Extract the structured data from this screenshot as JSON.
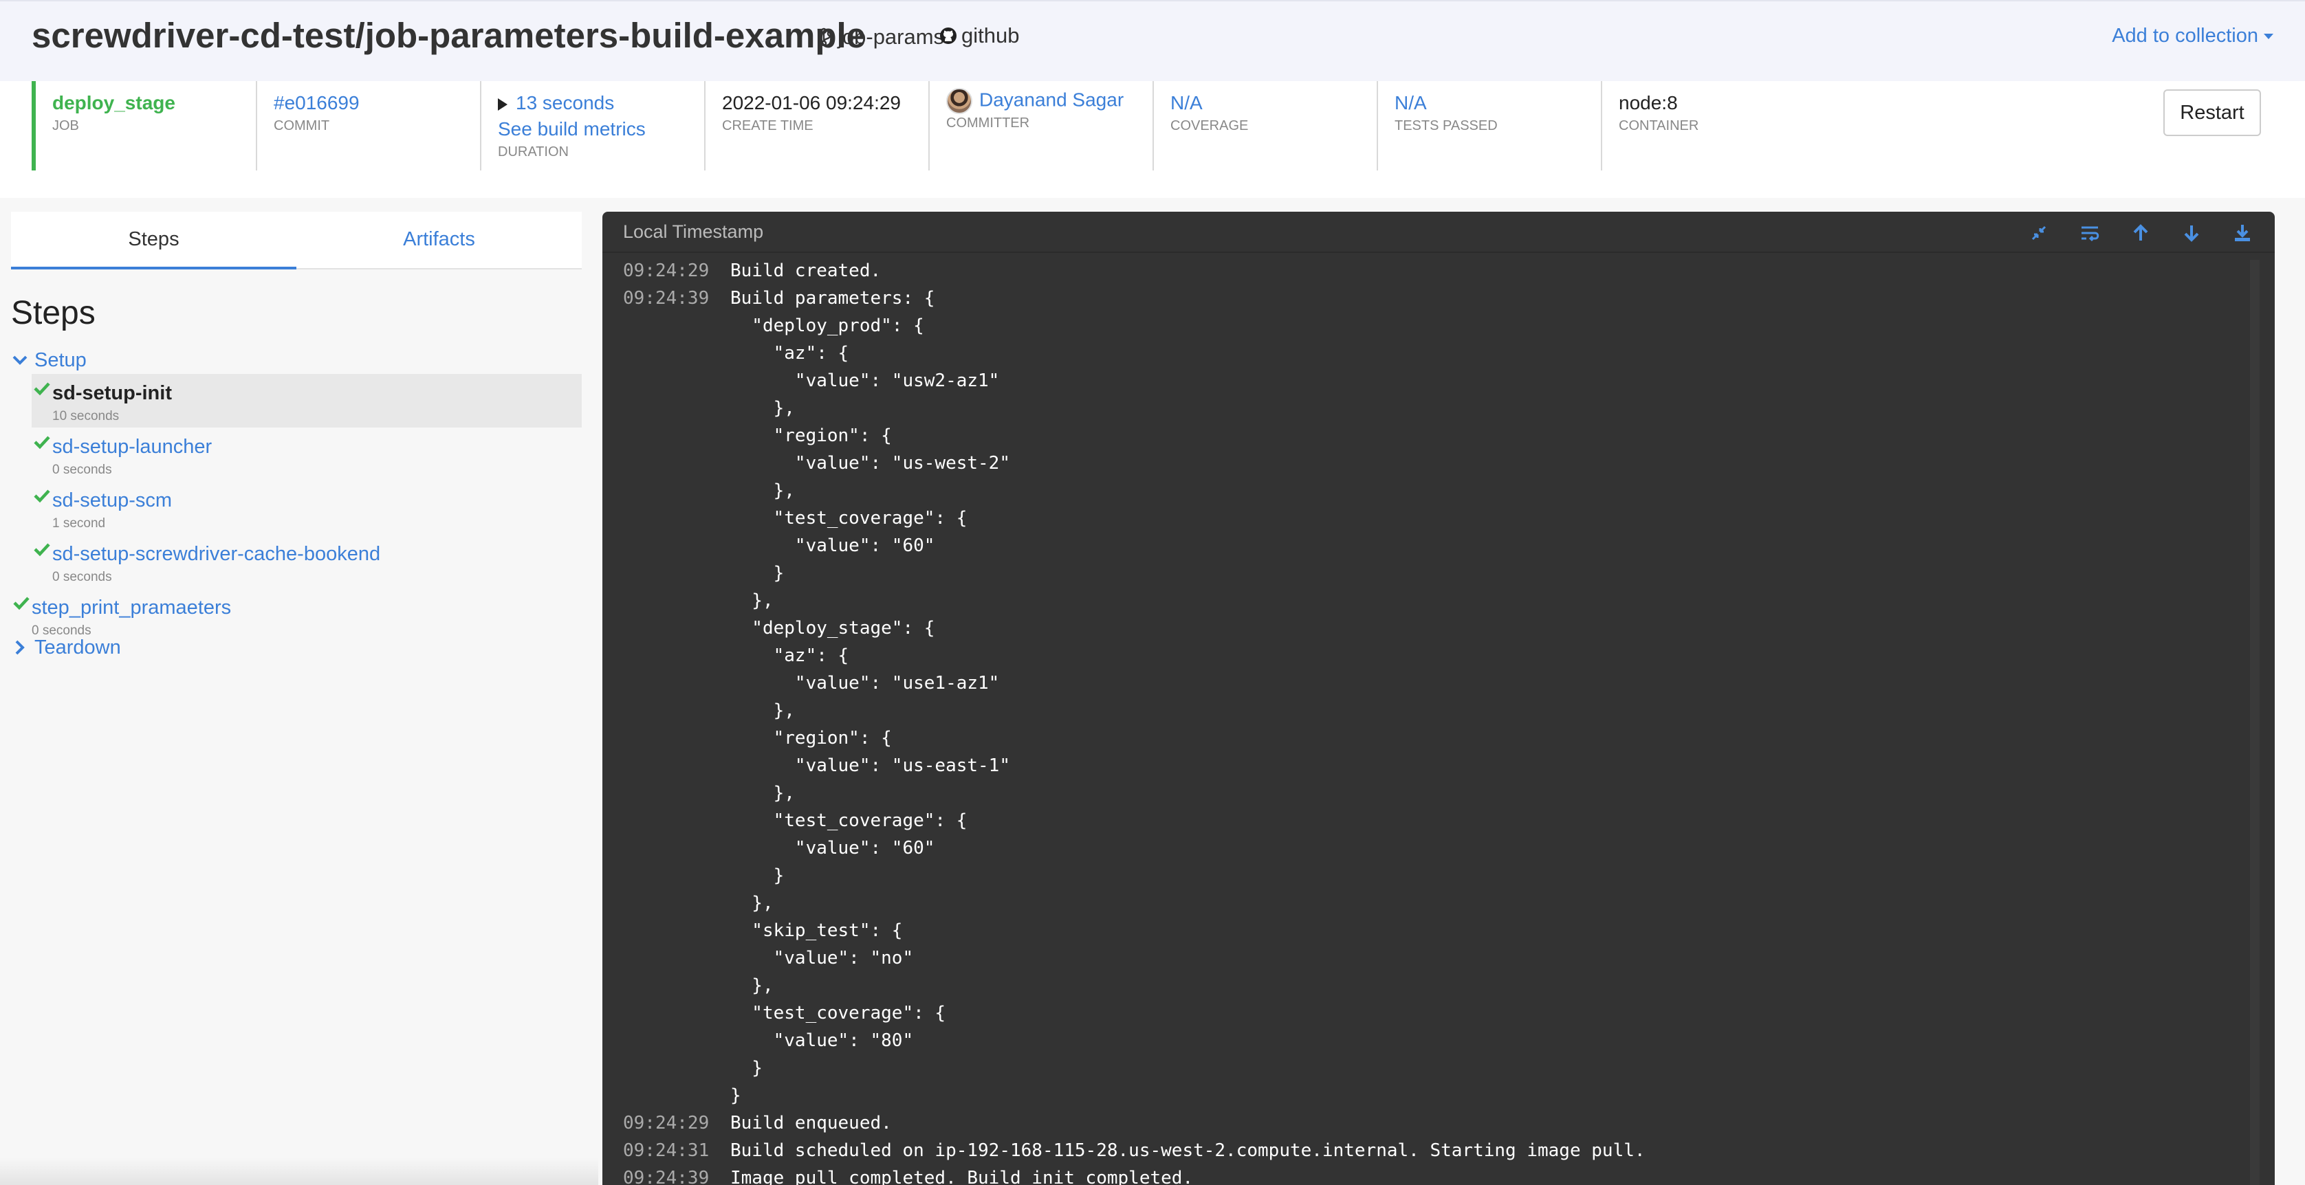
{
  "header": {
    "title": "screwdriver-cd-test/job-parameters-build-example",
    "branch": "job-params",
    "repo_source": "github",
    "add_to_collection": "Add to collection"
  },
  "info": {
    "job": {
      "value": "deploy_stage",
      "label": "JOB"
    },
    "commit": {
      "value": "#e016699",
      "label": "COMMIT"
    },
    "duration": {
      "value": "13 seconds",
      "metrics_link": "See build metrics",
      "label": "DURATION"
    },
    "create_time": {
      "value": "2022-01-06 09:24:29",
      "label": "CREATE TIME"
    },
    "committer": {
      "value": "Dayanand Sagar",
      "label": "COMMITTER"
    },
    "coverage": {
      "value": "N/A",
      "label": "COVERAGE"
    },
    "tests": {
      "value": "N/A",
      "label": "TESTS PASSED"
    },
    "container": {
      "value": "node:8",
      "label": "CONTAINER"
    },
    "restart_label": "Restart"
  },
  "tabs": {
    "steps": "Steps",
    "artifacts": "Artifacts"
  },
  "steps_heading": "Steps",
  "steps": {
    "setup_label": "Setup",
    "setup_steps": [
      {
        "name": "sd-setup-init",
        "duration": "10 seconds"
      },
      {
        "name": "sd-setup-launcher",
        "duration": "0 seconds"
      },
      {
        "name": "sd-setup-scm",
        "duration": "1 second"
      },
      {
        "name": "sd-setup-screwdriver-cache-bookend",
        "duration": "0 seconds"
      }
    ],
    "user_step": {
      "name": "step_print_pramaeters",
      "duration": "0 seconds"
    },
    "teardown_label": "Teardown"
  },
  "log": {
    "title": "Local Timestamp",
    "lines": [
      {
        "ts": "09:24:29",
        "text": "Build created."
      },
      {
        "ts": "09:24:39",
        "text": "Build parameters: {"
      },
      {
        "ts": "",
        "text": "  \"deploy_prod\": {"
      },
      {
        "ts": "",
        "text": "    \"az\": {"
      },
      {
        "ts": "",
        "text": "      \"value\": \"usw2-az1\""
      },
      {
        "ts": "",
        "text": "    },"
      },
      {
        "ts": "",
        "text": "    \"region\": {"
      },
      {
        "ts": "",
        "text": "      \"value\": \"us-west-2\""
      },
      {
        "ts": "",
        "text": "    },"
      },
      {
        "ts": "",
        "text": "    \"test_coverage\": {"
      },
      {
        "ts": "",
        "text": "      \"value\": \"60\""
      },
      {
        "ts": "",
        "text": "    }"
      },
      {
        "ts": "",
        "text": "  },"
      },
      {
        "ts": "",
        "text": "  \"deploy_stage\": {"
      },
      {
        "ts": "",
        "text": "    \"az\": {"
      },
      {
        "ts": "",
        "text": "      \"value\": \"use1-az1\""
      },
      {
        "ts": "",
        "text": "    },"
      },
      {
        "ts": "",
        "text": "    \"region\": {"
      },
      {
        "ts": "",
        "text": "      \"value\": \"us-east-1\""
      },
      {
        "ts": "",
        "text": "    },"
      },
      {
        "ts": "",
        "text": "    \"test_coverage\": {"
      },
      {
        "ts": "",
        "text": "      \"value\": \"60\""
      },
      {
        "ts": "",
        "text": "    }"
      },
      {
        "ts": "",
        "text": "  },"
      },
      {
        "ts": "",
        "text": "  \"skip_test\": {"
      },
      {
        "ts": "",
        "text": "    \"value\": \"no\""
      },
      {
        "ts": "",
        "text": "  },"
      },
      {
        "ts": "",
        "text": "  \"test_coverage\": {"
      },
      {
        "ts": "",
        "text": "    \"value\": \"80\""
      },
      {
        "ts": "",
        "text": "  }"
      },
      {
        "ts": "",
        "text": "}"
      },
      {
        "ts": "09:24:29",
        "text": "Build enqueued."
      },
      {
        "ts": "09:24:31",
        "text": "Build scheduled on ip-192-168-115-28.us-west-2.compute.internal. Starting image pull."
      },
      {
        "ts": "09:24:39",
        "text": "Image pull completed. Build init completed."
      }
    ]
  },
  "colors": {
    "success": "#3fb34f",
    "link": "#3b7fd8",
    "log_bg": "#333333"
  }
}
